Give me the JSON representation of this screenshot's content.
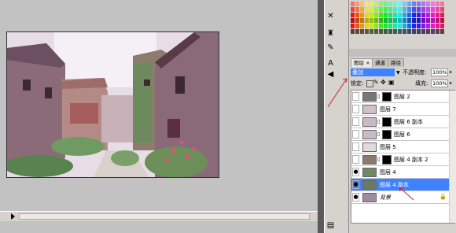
{
  "layers_panel": {
    "tabs": [
      {
        "label": "图层 ×",
        "active": true
      },
      {
        "label": "通道",
        "active": false
      },
      {
        "label": "路径",
        "active": false
      }
    ],
    "blend_mode": "叠加",
    "opacity_label": "不透明度:",
    "opacity_value": "100%",
    "lock_label": "锁定:",
    "fill_label": "填充:",
    "fill_value": "100%",
    "layers": [
      {
        "name": "图层 2",
        "visible": false,
        "selected": false
      },
      {
        "name": "图层 7",
        "visible": false,
        "selected": false
      },
      {
        "name": "图层 6 副本",
        "visible": false,
        "selected": false
      },
      {
        "name": "图层 6",
        "visible": false,
        "selected": false
      },
      {
        "name": "图层 5",
        "visible": false,
        "selected": false
      },
      {
        "name": "图层 4 副本 2",
        "visible": false,
        "selected": false
      },
      {
        "name": "图层 4",
        "visible": true,
        "selected": false
      },
      {
        "name": "图层 4 副本",
        "visible": true,
        "selected": true
      },
      {
        "name": "背景",
        "visible": true,
        "selected": false
      }
    ]
  },
  "tools": [
    "wrench-icon",
    "stamp-icon",
    "brush-icon",
    "text-icon",
    "speaker-icon",
    "notes-icon"
  ],
  "colors": {
    "selection": "#3f82ff",
    "annotation_arrow": "#cc2222",
    "panel": "#d6d3ce"
  }
}
